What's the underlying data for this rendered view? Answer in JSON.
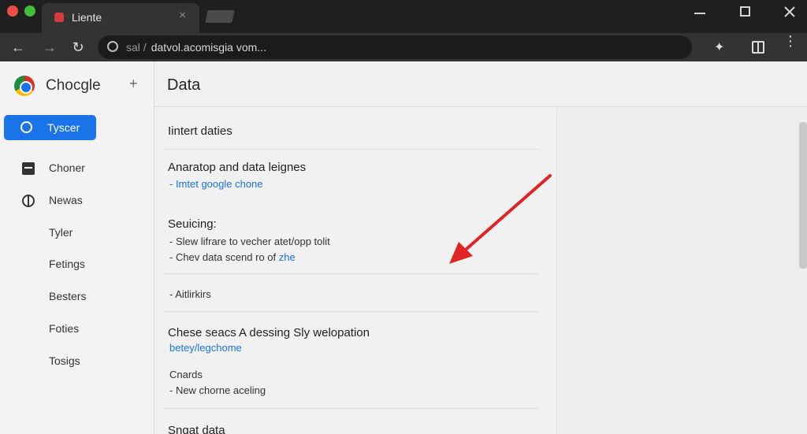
{
  "window": {
    "tab_title": "Liente",
    "tab_close": "×"
  },
  "toolbar": {
    "back": "←",
    "forward": "→",
    "reload": "↻",
    "address_prefix": "sal /",
    "address": "datvol.acomisgia vom...",
    "extension_icon": "puzzle-icon",
    "menu": "⋮"
  },
  "sidebar": {
    "brand": "Chocgle",
    "plus": "+",
    "active": {
      "label": "Tyscer"
    },
    "items": [
      {
        "label": "Choner",
        "icon": "calendar-icon"
      },
      {
        "label": "Newas",
        "icon": "globe-icon"
      },
      {
        "label": "Tyler"
      },
      {
        "label": "Fetings"
      },
      {
        "label": "Besters"
      },
      {
        "label": "Foties"
      },
      {
        "label": "Tosigs"
      }
    ]
  },
  "header": {
    "title": "Data"
  },
  "main": {
    "section1": {
      "title": "Iintert daties"
    },
    "section2": {
      "title": "Anaratop and data leignes",
      "link": "- Imtet google chone"
    },
    "section3": {
      "title": "Seuicing:",
      "line1": "- Slew lifrare to vecher atet/opp tolit",
      "line2_prefix": "- Chev data scend ro of ",
      "line2_link": "zhe"
    },
    "section4": {
      "line": "- Aitlirkirs"
    },
    "section5": {
      "title": "Chese seacs A dessing Sly welopation",
      "link": "betey/legchome",
      "sub_title": "Cnards",
      "sub_line": "- New chorne aceling"
    },
    "section6": {
      "title": "Sngat data"
    }
  },
  "colors": {
    "accent": "#1a73e8",
    "arrow": "#e02424",
    "titlebar": "#1f1f1f"
  }
}
